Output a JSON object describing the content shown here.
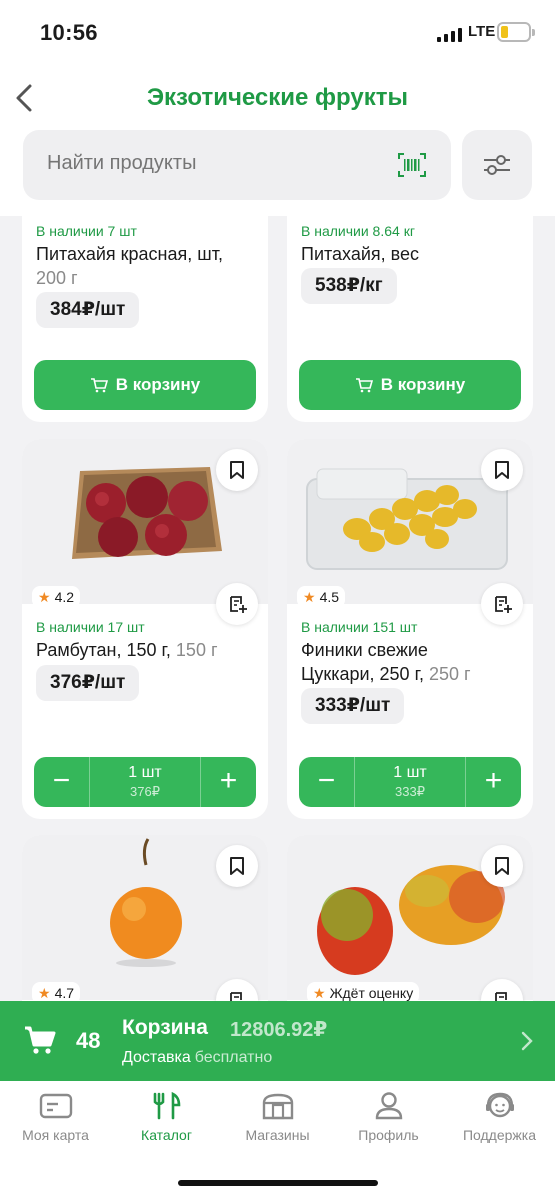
{
  "status_bar": {
    "time": "10:56",
    "network": "LTE"
  },
  "header": {
    "title": "Экзотические фрукты",
    "search_placeholder": "Найти продукты"
  },
  "products": [
    {
      "stock": "В наличии 7 шт",
      "name": "Питахайя красная, шт,",
      "weight": "200 г",
      "price": "384₽/шт",
      "cart_label": "В корзину"
    },
    {
      "stock": "В наличии 8.64 кг",
      "name": "Питахайя, вес",
      "weight": "",
      "price": "538₽/кг",
      "cart_label": "В корзину"
    },
    {
      "rating": "4.2",
      "stock": "В наличии 17 шт",
      "name": "Рамбутан, 150 г,",
      "weight": "150 г",
      "price": "376₽/шт",
      "qty": "1 шт",
      "sum": "376₽"
    },
    {
      "rating": "4.5",
      "stock": "В наличии 151 шт",
      "name": "Финики свежие Цуккари, 250 г,",
      "weight": "250 г",
      "price": "333₽/шт",
      "qty": "1 шт",
      "sum": "333₽"
    },
    {
      "rating": "4.7"
    },
    {
      "rating": "Ждёт оценку"
    }
  ],
  "cart": {
    "count": "48",
    "title": "Корзина",
    "total": "12806.92₽",
    "delivery_label": "Доставка",
    "delivery_value": "бесплатно"
  },
  "tabs": [
    {
      "label": "Моя карта",
      "icon": "card-icon"
    },
    {
      "label": "Каталог",
      "icon": "catalog-icon"
    },
    {
      "label": "Магазины",
      "icon": "store-icon"
    },
    {
      "label": "Профиль",
      "icon": "profile-icon"
    },
    {
      "label": "Поддержка",
      "icon": "support-icon"
    }
  ],
  "colors": {
    "brand": "#1f9a45",
    "button": "#35b75a",
    "cart_bar": "#2fae52",
    "rating_star": "#f08a24"
  }
}
